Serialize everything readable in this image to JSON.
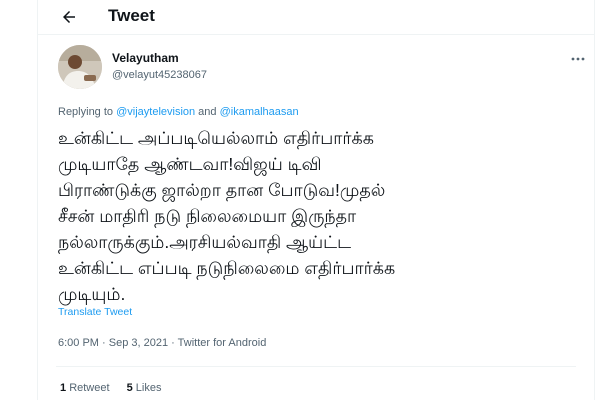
{
  "header": {
    "title": "Tweet",
    "back_icon": "arrow-left-icon"
  },
  "author": {
    "name": "Velayutham",
    "handle": "@velayut45238067",
    "avatar_icon": "profile-photo"
  },
  "more_icon": "more-horizontal-icon",
  "reply_context": {
    "prefix": "Replying to ",
    "mention1": "@vijaytelevision",
    "joiner": " and ",
    "mention2": "@ikamalhaasan"
  },
  "tweet": {
    "text": "உன்கிட்ட அப்படியெல்லாம் எதிர்பார்க்க\nமுடியாதே ஆண்டவா!விஜய் டிவி\nபிராண்டுக்கு ஜால்றா தான போடுவ!முதல்\nசீசன் மாதிரி நடு நிலைமையா இருந்தா\nநல்லாருக்கும்.அரசியல்வாதி ஆய்ட்ட\nஉன்கிட்ட எப்படி நடுநிலைமை எதிர்பார்க்க\nமுடியும்.",
    "translate_label": "Translate Tweet",
    "time": "6:00 PM",
    "separator1": " · ",
    "date": "Sep 3, 2021",
    "separator2": " · ",
    "source": "Twitter for Android"
  },
  "stats": {
    "retweets_count": "1",
    "retweets_label": "Retweet",
    "likes_count": "5",
    "likes_label": "Likes"
  },
  "colors": {
    "accent": "#1d9bf0",
    "secondary_text": "#536471",
    "primary_text": "#0f1419",
    "divider": "#eff3f4"
  }
}
